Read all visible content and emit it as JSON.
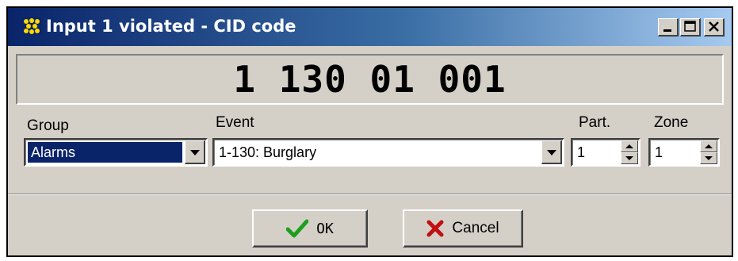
{
  "window": {
    "title": "Input 1 violated - CID code",
    "title_icon": "app-dots-icon",
    "controls": [
      "minimize-icon",
      "maximize-icon",
      "close-icon"
    ]
  },
  "code_display": {
    "value": "1 130 01 001"
  },
  "form": {
    "group": {
      "label": "Group",
      "value": "Alarms"
    },
    "event": {
      "label": "Event",
      "value": "1-130: Burglary"
    },
    "partition": {
      "label": "Part.",
      "value": "1"
    },
    "zone": {
      "label": "Zone",
      "value": "1"
    }
  },
  "buttons": {
    "ok": {
      "label": "OK",
      "icon": "checkmark-icon"
    },
    "cancel": {
      "label": "Cancel",
      "icon": "x-icon"
    }
  },
  "colors": {
    "titlebar_start": "#0a246a",
    "titlebar_end": "#a6caf0",
    "face": "#d4d0c8",
    "selection": "#0a246a",
    "ok_icon": "#1e9e1e",
    "cancel_icon": "#c01010"
  }
}
